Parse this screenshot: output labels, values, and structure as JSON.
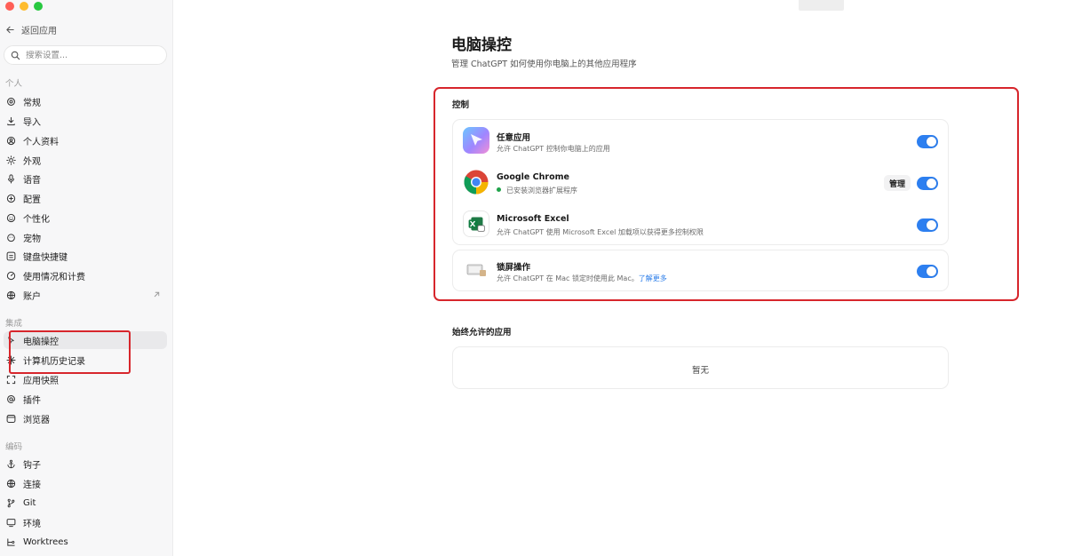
{
  "sidebar": {
    "back_label": "返回应用",
    "search_placeholder": "搜索设置...",
    "sections": {
      "personal": "个人",
      "integrations": "集成",
      "coding": "编码"
    },
    "personal_items": [
      {
        "label": "常规",
        "icon": "gear-icon"
      },
      {
        "label": "导入",
        "icon": "download-icon"
      },
      {
        "label": "个人资料",
        "icon": "user-icon"
      },
      {
        "label": "外观",
        "icon": "sun-icon"
      },
      {
        "label": "语音",
        "icon": "microphone-icon"
      },
      {
        "label": "配置",
        "icon": "settings-icon"
      },
      {
        "label": "个性化",
        "icon": "smile-icon"
      },
      {
        "label": "宠物",
        "icon": "pet-icon"
      },
      {
        "label": "键盘快捷键",
        "icon": "keyboard-icon"
      },
      {
        "label": "使用情况和计费",
        "icon": "gauge-icon"
      },
      {
        "label": "账户",
        "icon": "globe-icon"
      }
    ],
    "integration_items": [
      {
        "label": "电脑操控",
        "icon": "cursor-icon",
        "active": true
      },
      {
        "label": "计算机历史记录",
        "icon": "sparkle-icon"
      },
      {
        "label": "应用快照",
        "icon": "snapshot-icon"
      },
      {
        "label": "插件",
        "icon": "at-icon"
      },
      {
        "label": "浏览器",
        "icon": "browser-icon"
      }
    ],
    "coding_items": [
      {
        "label": "钩子",
        "icon": "anchor-icon"
      },
      {
        "label": "连接",
        "icon": "globe-icon"
      },
      {
        "label": "Git",
        "icon": "git-branch-icon"
      },
      {
        "label": "环境",
        "icon": "monitor-icon"
      },
      {
        "label": "Worktrees",
        "icon": "worktree-icon"
      }
    ]
  },
  "main": {
    "title": "电脑操控",
    "subtitle": "管理 ChatGPT 如何使用你电脑上的其他应用程序",
    "control": {
      "label": "控制",
      "apps": [
        {
          "title": "任意应用",
          "desc": "允许 ChatGPT 控制你电脑上的应用",
          "enabled": true
        },
        {
          "title": "Google Chrome",
          "desc": "已安装浏览器扩展程序",
          "enabled": true,
          "manage_label": "管理"
        },
        {
          "title": "Microsoft Excel",
          "desc": "允许 ChatGPT 使用 Microsoft Excel 加载项以获得更多控制权限",
          "enabled": true
        }
      ],
      "lock_screen": {
        "title": "锁屏操作",
        "desc": "允许 ChatGPT 在 Mac 锁定时使用此 Mac。",
        "link": "了解更多",
        "enabled": true
      }
    },
    "always_allowed": {
      "label": "始终允许的应用",
      "empty_text": "暂无"
    }
  },
  "colors": {
    "accent": "#2d7ff0",
    "highlight_border": "#d7262c",
    "status_green": "#1fa34a",
    "link": "#2b7de9"
  }
}
